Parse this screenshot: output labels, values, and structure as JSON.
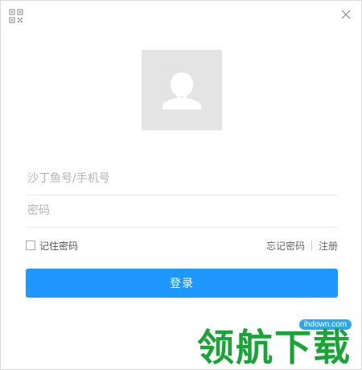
{
  "window": {
    "qr_icon": "qr-code-icon",
    "close_icon": "close-icon"
  },
  "avatar": {
    "icon": "user-avatar-icon",
    "background": "#e4e4e4"
  },
  "form": {
    "account_placeholder": "沙丁鱼号/手机号",
    "account_value": "",
    "password_placeholder": "密码",
    "password_value": ""
  },
  "options": {
    "remember_label": "记住密码",
    "remember_checked": false,
    "forgot_label": "忘记密码",
    "register_label": "注册"
  },
  "login_button": {
    "label": "登录",
    "color": "#1e97ff"
  },
  "watermark": {
    "url": "ihdown.com",
    "text": "领航下载"
  }
}
